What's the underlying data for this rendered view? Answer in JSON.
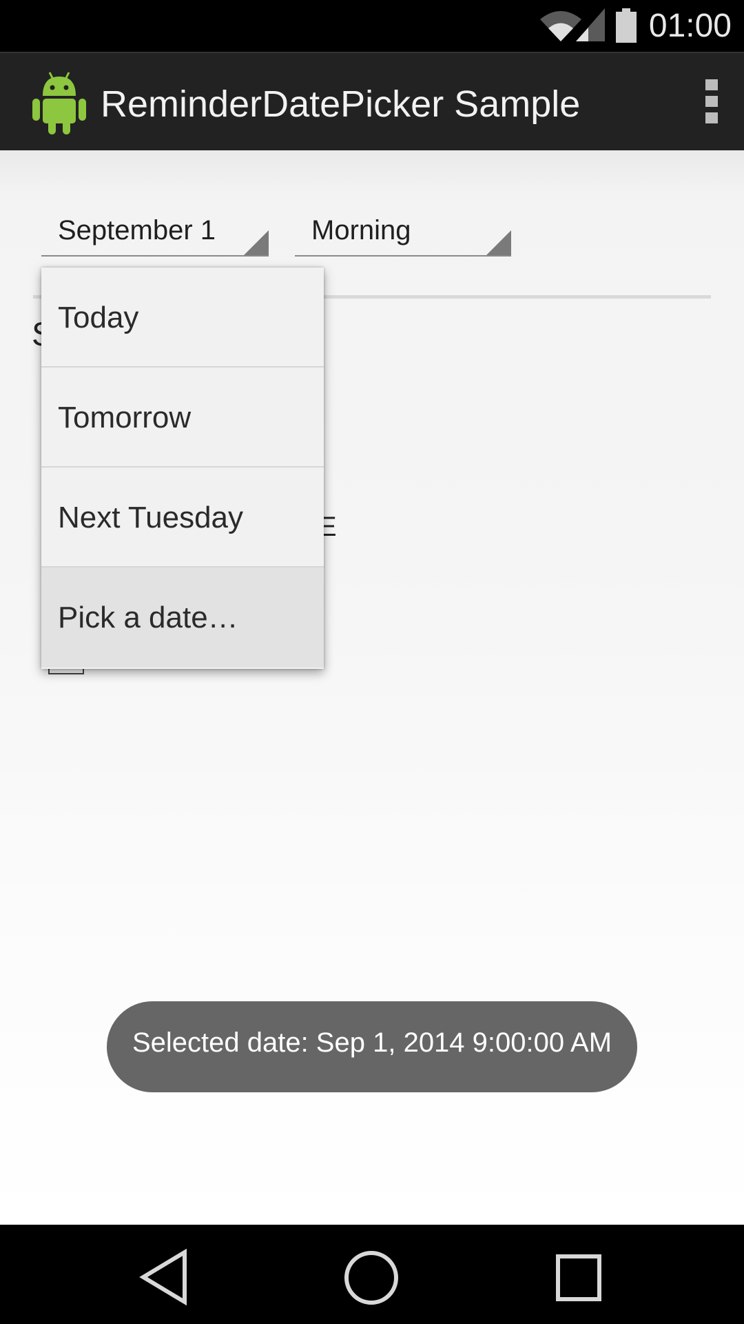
{
  "status_bar": {
    "time": "01:00",
    "icons": [
      "wifi-icon",
      "cell-signal-icon",
      "battery-icon"
    ]
  },
  "action_bar": {
    "title": "ReminderDatePicker Sample",
    "logo_icon": "android-robot-icon",
    "overflow_icon": "overflow-menu-icon"
  },
  "pickers": {
    "date_selected": "September 1",
    "time_selected": "Morning"
  },
  "dropdown": {
    "items": [
      {
        "label": "Today"
      },
      {
        "label": "Tomorrow"
      },
      {
        "label": "Next Tuesday"
      },
      {
        "label": "Pick a date…"
      }
    ]
  },
  "background_partial": {
    "left_letter": "S",
    "right_letter": "E"
  },
  "toast": {
    "message": "Selected date: Sep 1, 2014 9:00:00 AM"
  },
  "nav_bar": {
    "icons": [
      "back-icon",
      "home-icon",
      "recents-icon"
    ]
  },
  "colors": {
    "action_bar": "#222222",
    "android_green": "#8dc63f",
    "toast_bg": "#666666"
  }
}
